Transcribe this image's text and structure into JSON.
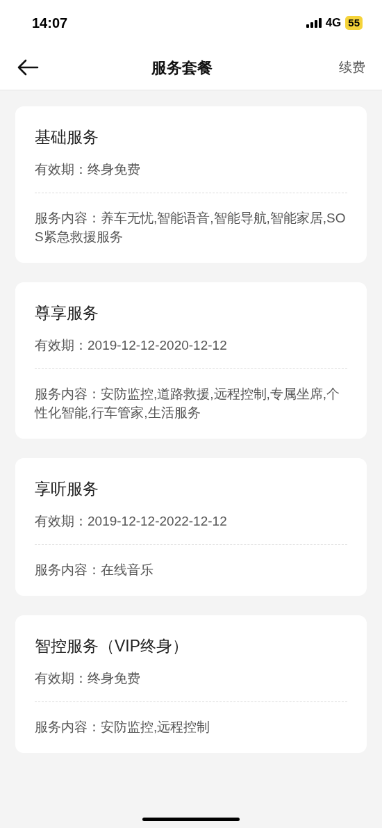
{
  "status_bar": {
    "time": "14:07",
    "network": "4G",
    "battery": "55"
  },
  "header": {
    "title": "服务套餐",
    "action": "续费"
  },
  "packages": [
    {
      "name": "基础服务",
      "validity": "有效期：终身免费",
      "content": "服务内容：养车无忧,智能语音,智能导航,智能家居,SOS紧急救援服务"
    },
    {
      "name": "尊享服务",
      "validity": "有效期：2019-12-12-2020-12-12",
      "content": "服务内容：安防监控,道路救援,远程控制,专属坐席,个性化智能,行车管家,生活服务"
    },
    {
      "name": "享听服务",
      "validity": "有效期：2019-12-12-2022-12-12",
      "content": "服务内容：在线音乐"
    },
    {
      "name": "智控服务（VIP终身）",
      "validity": "有效期：终身免费",
      "content": "服务内容：安防监控,远程控制"
    }
  ]
}
